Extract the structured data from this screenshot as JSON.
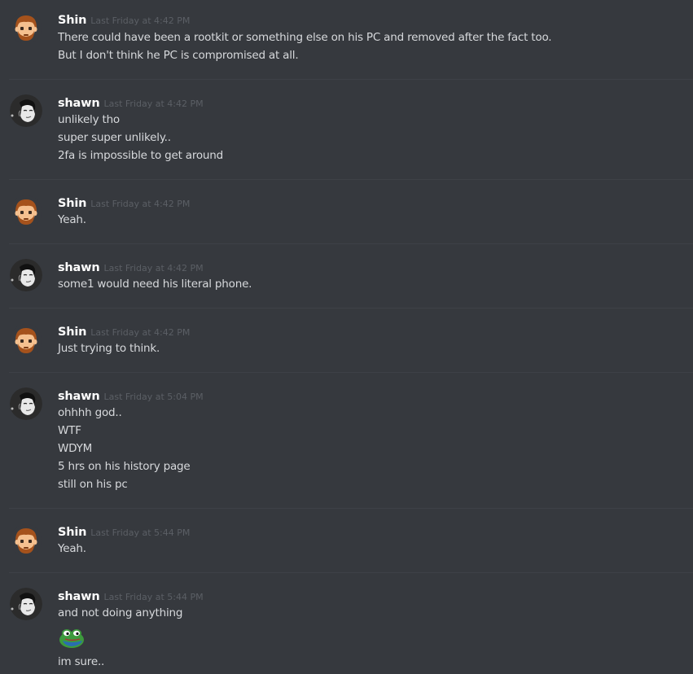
{
  "users": {
    "shin": {
      "name": "Shin",
      "avatar_icon": "bearded-man-avatar-icon",
      "avatar_bg": "#f4f0e4",
      "hair": "#a5521c",
      "skin": "#f5c08f"
    },
    "shawn": {
      "name": "shawn",
      "avatar_icon": "sketch-face-avatar-icon",
      "avatar_bg": "#2b2b2b"
    }
  },
  "messages": [
    {
      "author": "Shin",
      "timestamp": "Last Friday at 4:42 PM",
      "lines": [
        "There could have been a rootkit or something else on his PC and removed after the fact too.",
        "But I don't think he PC is compromised at all."
      ]
    },
    {
      "author": "shawn",
      "timestamp": "Last Friday at 4:42 PM",
      "lines": [
        "unlikely tho",
        "super super unlikely..",
        "2fa is impossible to get around"
      ]
    },
    {
      "author": "Shin",
      "timestamp": "Last Friday at 4:42 PM",
      "lines": [
        "Yeah."
      ]
    },
    {
      "author": "shawn",
      "timestamp": "Last Friday at 4:42 PM",
      "lines": [
        "some1 would need his literal phone."
      ]
    },
    {
      "author": "Shin",
      "timestamp": "Last Friday at 4:42 PM",
      "lines": [
        "Just trying to think."
      ]
    },
    {
      "author": "shawn",
      "timestamp": "Last Friday at 5:04 PM",
      "lines": [
        "ohhhh god..",
        "WTF",
        "WDYM",
        "5 hrs on his history page",
        "still on his pc"
      ]
    },
    {
      "author": "Shin",
      "timestamp": "Last Friday at 5:44 PM",
      "lines": [
        "Yeah."
      ]
    },
    {
      "author": "shawn",
      "timestamp": "Last Friday at 5:44 PM",
      "lines": [
        "and not doing anything",
        "im sure.."
      ],
      "emoji": "pepe-frog-emoji-icon"
    }
  ],
  "colors": {
    "background": "#36393e",
    "divider": "#3e4147",
    "username": "#ffffff",
    "timestamp": "#5b5f65",
    "message_text": "#d7d9dc",
    "emoji_green": "#3d9a3d"
  }
}
